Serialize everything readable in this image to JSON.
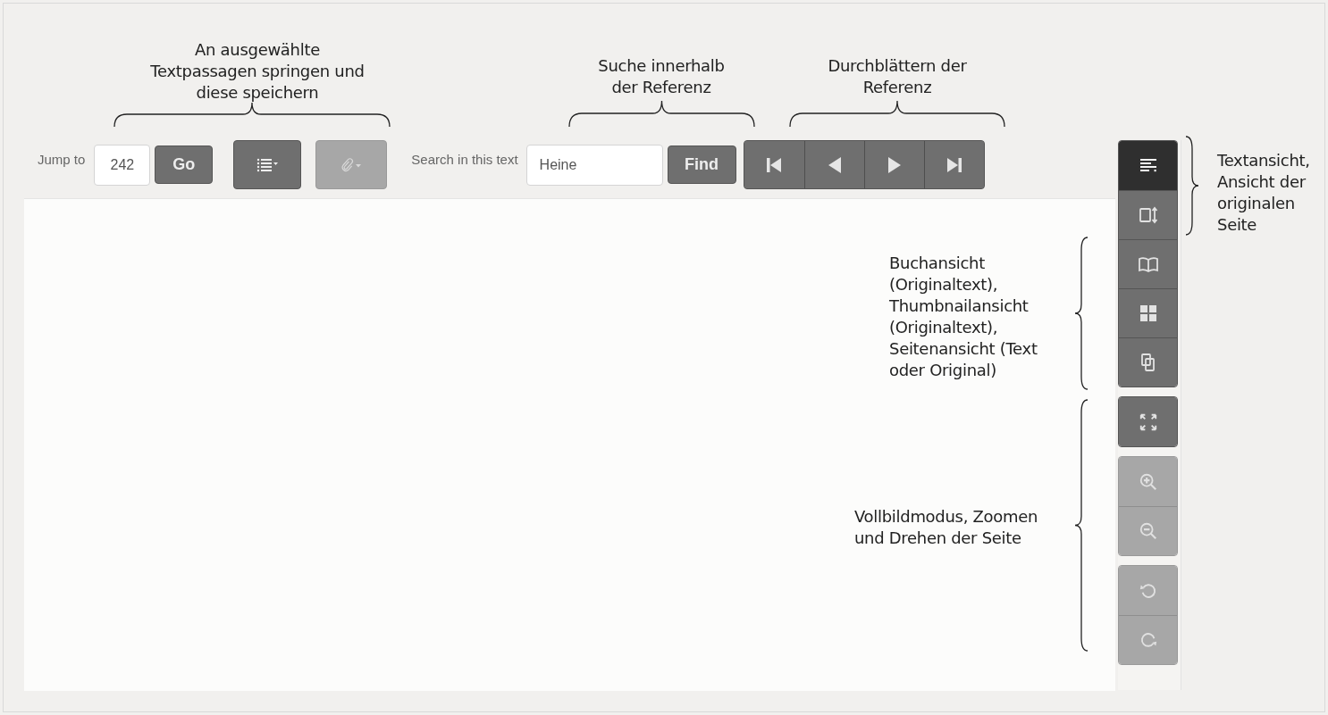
{
  "toolbar": {
    "jump_label": "Jump to",
    "jump_value": "242",
    "go_label": "Go",
    "menus": [
      {
        "kind": "list",
        "disabled": false
      },
      {
        "kind": "paperclip",
        "disabled": true
      }
    ],
    "search_label": "Search in this text",
    "search_value": "Heine",
    "find_label": "Find",
    "pager": [
      {
        "kind": "first"
      },
      {
        "kind": "prev"
      },
      {
        "kind": "next"
      },
      {
        "kind": "last"
      }
    ]
  },
  "side_toolbar": {
    "views": [
      {
        "kind": "lines",
        "selected": true
      },
      {
        "kind": "page-arrows",
        "selected": false
      },
      {
        "kind": "book",
        "selected": false
      },
      {
        "kind": "grid",
        "selected": false
      },
      {
        "kind": "pages",
        "selected": false
      }
    ],
    "tools": [
      [
        {
          "kind": "expand",
          "disabled": false
        }
      ],
      [
        {
          "kind": "zoom-in",
          "disabled": true
        },
        {
          "kind": "zoom-out",
          "disabled": true
        }
      ],
      [
        {
          "kind": "rotate-left",
          "disabled": true
        },
        {
          "kind": "rotate-right",
          "disabled": true
        }
      ]
    ]
  },
  "annotations": [
    {
      "text": "An ausgewählte\nTextpassagen springen und\ndiese speichern",
      "kind": "below"
    },
    {
      "text": "Suche innerhalb\nder Referenz",
      "kind": "below"
    },
    {
      "text": "Durchblättern der\nReferenz",
      "kind": "below"
    },
    {
      "text": "Textansicht,\nAnsicht der\noriginalen\nSeite",
      "kind": "left"
    },
    {
      "text": "Buchansicht\n(Originaltext),\nThumbnailansicht\n(Originaltext),\nSeitenansicht (Text\noder Original)",
      "kind": "right"
    },
    {
      "text": "Vollbildmodus, Zoomen\nund Drehen der Seite",
      "kind": "right"
    }
  ]
}
